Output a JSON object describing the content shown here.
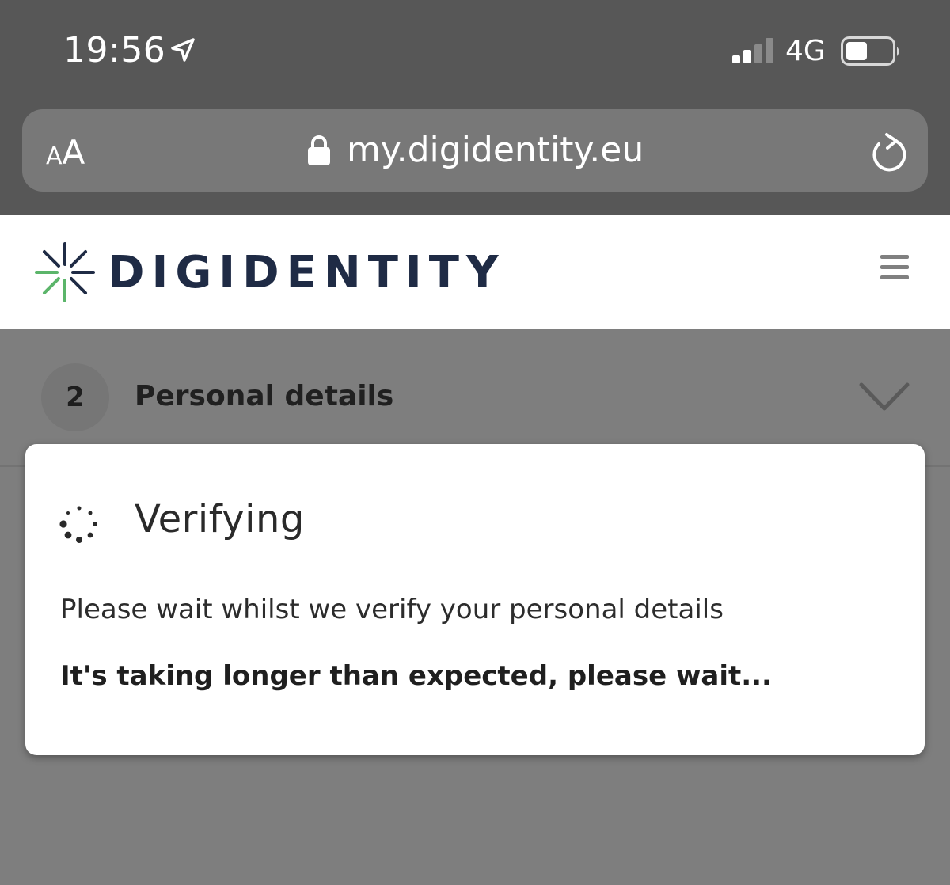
{
  "status_bar": {
    "time": "19:56",
    "network": "4G",
    "icons": [
      "location-arrow-icon",
      "cellular-signal-icon",
      "battery-icon"
    ]
  },
  "browser": {
    "text_size_small": "A",
    "text_size_large": "A",
    "url": "my.digidentity.eu",
    "icons": [
      "lock-icon",
      "reload-icon"
    ]
  },
  "header": {
    "logo_text": "DIGIDENTITY",
    "icons": [
      "digidentity-logo-icon",
      "hamburger-menu-icon"
    ]
  },
  "step": {
    "number": "2",
    "title": "Personal details",
    "icons": [
      "chevron-down-icon"
    ]
  },
  "modal": {
    "title": "Verifying",
    "message": "Please wait whilst we verify your personal details",
    "notice": "It's taking longer than expected, please wait...",
    "icons": [
      "spinner-icon"
    ]
  },
  "colors": {
    "status_bar_bg": "#575757",
    "overlay_bg": "#7e7e7e",
    "brand_navy": "#1f2b45",
    "brand_green": "#5bb56a"
  }
}
